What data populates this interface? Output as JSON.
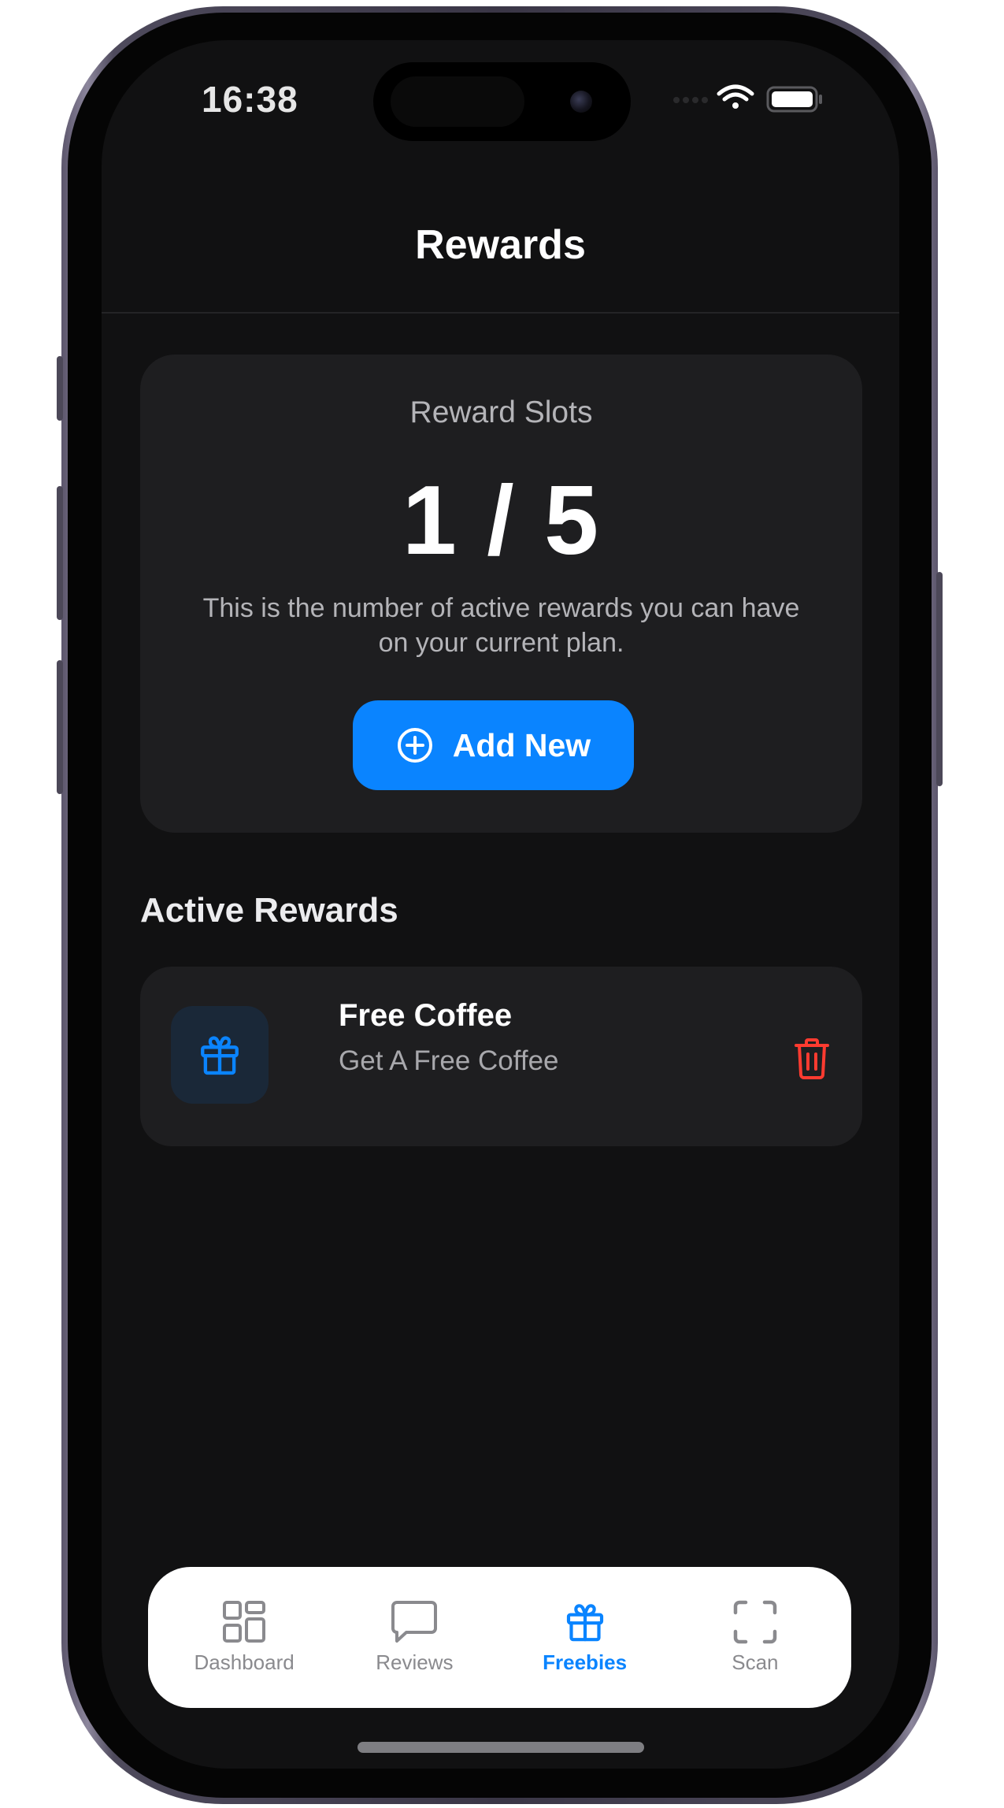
{
  "status_bar": {
    "time": "16:38",
    "icons": [
      "signal-icon",
      "wifi-icon",
      "battery-icon"
    ]
  },
  "header": {
    "title": "Rewards"
  },
  "slots": {
    "label": "Reward Slots",
    "count_text": "1 / 5",
    "used": 1,
    "total": 5,
    "description": "This is the number of active rewards you can have on your current plan.",
    "add_button_label": "Add New",
    "add_button_icon": "plus-circle-icon"
  },
  "active_rewards": {
    "title": "Active Rewards",
    "items": [
      {
        "name": "Free Coffee",
        "description": "Get A Free Coffee",
        "icon": "gift-icon",
        "action_icon": "trash-icon"
      }
    ]
  },
  "tab_bar": {
    "tabs": [
      {
        "label": "Dashboard",
        "icon": "grid-icon",
        "active": false
      },
      {
        "label": "Reviews",
        "icon": "chat-bubble-icon",
        "active": false
      },
      {
        "label": "Freebies",
        "icon": "gift-icon",
        "active": true
      },
      {
        "label": "Scan",
        "icon": "scan-frame-icon",
        "active": false
      }
    ]
  },
  "colors": {
    "accent": "#0a84ff",
    "danger": "#ff3b30",
    "background": "#111112",
    "card": "#1e1e20"
  }
}
